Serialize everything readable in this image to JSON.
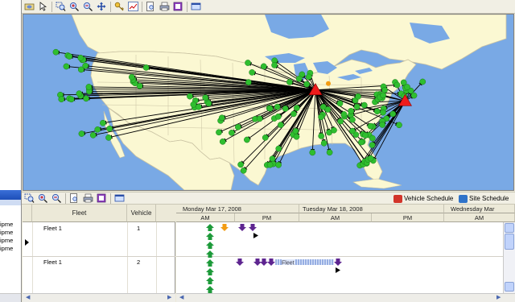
{
  "left_panel": {
    "lines": [
      "ipme",
      "ipme",
      "ipme",
      "ipme"
    ]
  },
  "map_toolbar": {
    "icons": [
      "open-icon",
      "pointer-icon",
      "zoom-window-icon",
      "zoom-in-icon",
      "zoom-out-icon",
      "pan-icon",
      "key-icon",
      "chart-icon",
      "print-preview-icon",
      "print-icon",
      "copy-icon",
      "window-icon"
    ]
  },
  "map": {
    "land_color": "#fbf8d2",
    "water_color": "#79a9e5",
    "site_color": "#2fbe2f",
    "depot_color": "#ee1b1b",
    "depots": [
      {
        "name": "depot-midwest",
        "lon": -87.6,
        "lat": 41.9
      },
      {
        "name": "depot-east",
        "lon": -75.2,
        "lat": 40.0
      }
    ],
    "origin_marker_color": "#f39c12"
  },
  "schedule_toolbar": {
    "icons": [
      "zoom-window-icon",
      "zoom-in-icon",
      "zoom-out-icon",
      "print-preview-icon",
      "print-icon",
      "copy-icon",
      "window-icon"
    ],
    "vehicle_schedule_label": "Vehicle Schedule",
    "site_schedule_label": "Site Schedule"
  },
  "grid": {
    "columns": [
      "Fleet",
      "Vehicle"
    ],
    "rows": [
      {
        "fleet": "Fleet 1",
        "vehicle": "1",
        "selected": true
      },
      {
        "fleet": "Fleet 1",
        "vehicle": "2",
        "selected": false
      }
    ]
  },
  "timeline": {
    "days": [
      "Monday Mar 17, 2008",
      "Tuesday Mar 18, 2008",
      "Wednesday Mar"
    ],
    "periods": [
      "AM",
      "PM",
      "AM",
      "PM",
      "AM"
    ],
    "bar_label": "Fleet"
  }
}
